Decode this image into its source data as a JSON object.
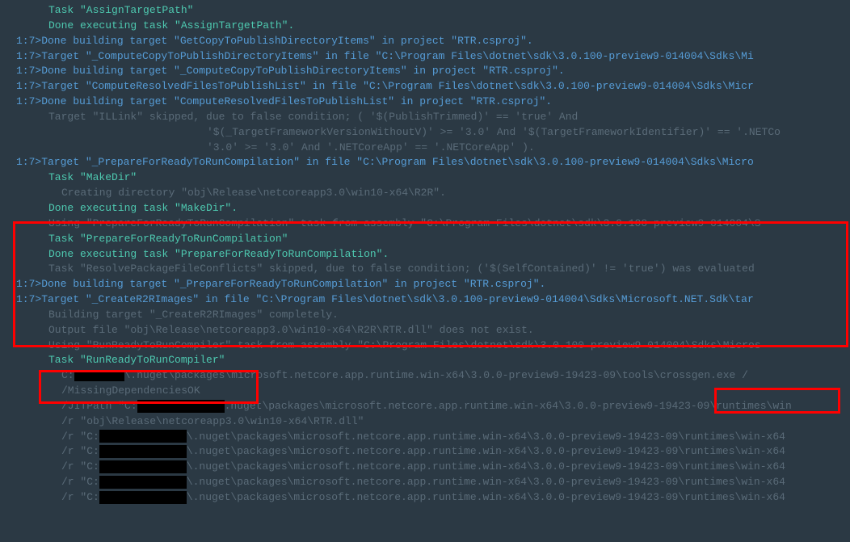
{
  "lines": [
    {
      "cls": "task indent1",
      "text": "Task \"AssignTargetPath\""
    },
    {
      "cls": "task indent1",
      "text": "Done executing task \"AssignTargetPath\"."
    },
    {
      "cls": "high line",
      "text": "1:7>Done building target \"GetCopyToPublishDirectoryItems\" in project \"RTR.csproj\"."
    },
    {
      "cls": "high line",
      "text": "1:7>Target \"_ComputeCopyToPublishDirectoryItems\" in file \"C:\\Program Files\\dotnet\\sdk\\3.0.100-preview9-014004\\Sdks\\Mi"
    },
    {
      "cls": "high line",
      "text": "1:7>Done building target \"_ComputeCopyToPublishDirectoryItems\" in project \"RTR.csproj\"."
    },
    {
      "cls": "high line",
      "text": "1:7>Target \"ComputeResolvedFilesToPublishList\" in file \"C:\\Program Files\\dotnet\\sdk\\3.0.100-preview9-014004\\Sdks\\Micr"
    },
    {
      "cls": "high line",
      "text": "1:7>Done building target \"ComputeResolvedFilesToPublishList\" in project \"RTR.csproj\"."
    },
    {
      "cls": "dim indent1",
      "text": "Target \"ILLink\" skipped, due to false condition; ( '$(PublishTrimmed)' == 'true' And"
    },
    {
      "cls": "dim indent3",
      "text": "'$(_TargetFrameworkVersionWithoutV)' >= '3.0' And '$(TargetFrameworkIdentifier)' == '.NETCo"
    },
    {
      "cls": "dim indent3",
      "text": "'3.0' >= '3.0' And '.NETCoreApp' == '.NETCoreApp' )."
    },
    {
      "cls": "high line",
      "text": "1:7>Target \"_PrepareForReadyToRunCompilation\" in file \"C:\\Program Files\\dotnet\\sdk\\3.0.100-preview9-014004\\Sdks\\Micro"
    },
    {
      "cls": "task indent1",
      "text": "Task \"MakeDir\""
    },
    {
      "cls": "dim indent2",
      "text": "Creating directory \"obj\\Release\\netcoreapp3.0\\win10-x64\\R2R\"."
    },
    {
      "cls": "task indent1",
      "text": "Done executing task \"MakeDir\"."
    },
    {
      "cls": "dim indent1",
      "text": "Using \"PrepareForReadyToRunCompilation\" task from assembly \"C:\\Program Files\\dotnet\\sdk\\3.0.100-preview9-014004\\S"
    },
    {
      "cls": "task indent1",
      "text": "Task \"PrepareForReadyToRunCompilation\""
    },
    {
      "cls": "task indent1",
      "text": "Done executing task \"PrepareForReadyToRunCompilation\"."
    },
    {
      "cls": "dim indent1",
      "text": "Task \"ResolvePackageFileConflicts\" skipped, due to false condition; ('$(SelfContained)' != 'true') was evaluated "
    },
    {
      "cls": "high line",
      "text": "1:7>Done building target \"_PrepareForReadyToRunCompilation\" in project \"RTR.csproj\"."
    },
    {
      "cls": "high line",
      "text": "1:7>Target \"_CreateR2RImages\" in file \"C:\\Program Files\\dotnet\\sdk\\3.0.100-preview9-014004\\Sdks\\Microsoft.NET.Sdk\\tar"
    },
    {
      "cls": "dim indent1",
      "text": "Building target \"_CreateR2RImages\" completely."
    },
    {
      "cls": "dim indent1",
      "text": "Output file \"obj\\Release\\netcoreapp3.0\\win10-x64\\R2R\\RTR.dll\" does not exist."
    },
    {
      "cls": "dim indent1",
      "text": "Using \"RunReadyToRunCompiler\" task from assembly \"C:\\Program Files\\dotnet\\sdk\\3.0.100-preview9-014004\\Sdks\\Micros"
    },
    {
      "cls": "task indent1",
      "text": "Task \"RunReadyToRunCompiler\""
    },
    {
      "cls": "dim indent2",
      "redact": "sm",
      "pre": "C:",
      "text": "\\.nuget\\packages\\microsoft.netcore.app.runtime.win-x64\\3.0.0-preview9-19423-09\\tools\\crossgen.exe /"
    },
    {
      "cls": "dim indent2",
      "text": "/MissingDependenciesOK"
    },
    {
      "cls": "dim indent2",
      "redact": "lg",
      "pre": "/JITPath \"C:",
      "text": ".nuget\\packages\\microsoft.netcore.app.runtime.win-x64\\3.0.0-preview9-19423-09\\runtimes\\win"
    },
    {
      "cls": "dim indent2",
      "text": "/r \"obj\\Release\\netcoreapp3.0\\win10-x64\\RTR.dll\""
    },
    {
      "cls": "dim indent2",
      "redact": "lg",
      "pre": "/r \"C:",
      "text": "\\.nuget\\packages\\microsoft.netcore.app.runtime.win-x64\\3.0.0-preview9-19423-09\\runtimes\\win-x64"
    },
    {
      "cls": "dim indent2",
      "redact": "lg",
      "pre": "/r \"C:",
      "text": "\\.nuget\\packages\\microsoft.netcore.app.runtime.win-x64\\3.0.0-preview9-19423-09\\runtimes\\win-x64"
    },
    {
      "cls": "dim indent2",
      "redact": "lg",
      "pre": "/r \"C:",
      "text": "\\.nuget\\packages\\microsoft.netcore.app.runtime.win-x64\\3.0.0-preview9-19423-09\\runtimes\\win-x64"
    },
    {
      "cls": "dim indent2",
      "redact": "lg",
      "pre": "/r \"C:",
      "text": "\\.nuget\\packages\\microsoft.netcore.app.runtime.win-x64\\3.0.0-preview9-19423-09\\runtimes\\win-x64"
    },
    {
      "cls": "dim indent2",
      "redact": "lg",
      "pre": "/r \"C:",
      "text": "\\.nuget\\packages\\microsoft.netcore.app.runtime.win-x64\\3.0.0-preview9-19423-09\\runtimes\\win-x64"
    }
  ],
  "annotations": {
    "box1_desc": "PrepareForReadyToRunCompilation / CreateR2RImages block highlight",
    "box2_desc": "Task RunReadyToRunCompiler highlight",
    "box3_desc": "crossgen.exe highlight"
  }
}
